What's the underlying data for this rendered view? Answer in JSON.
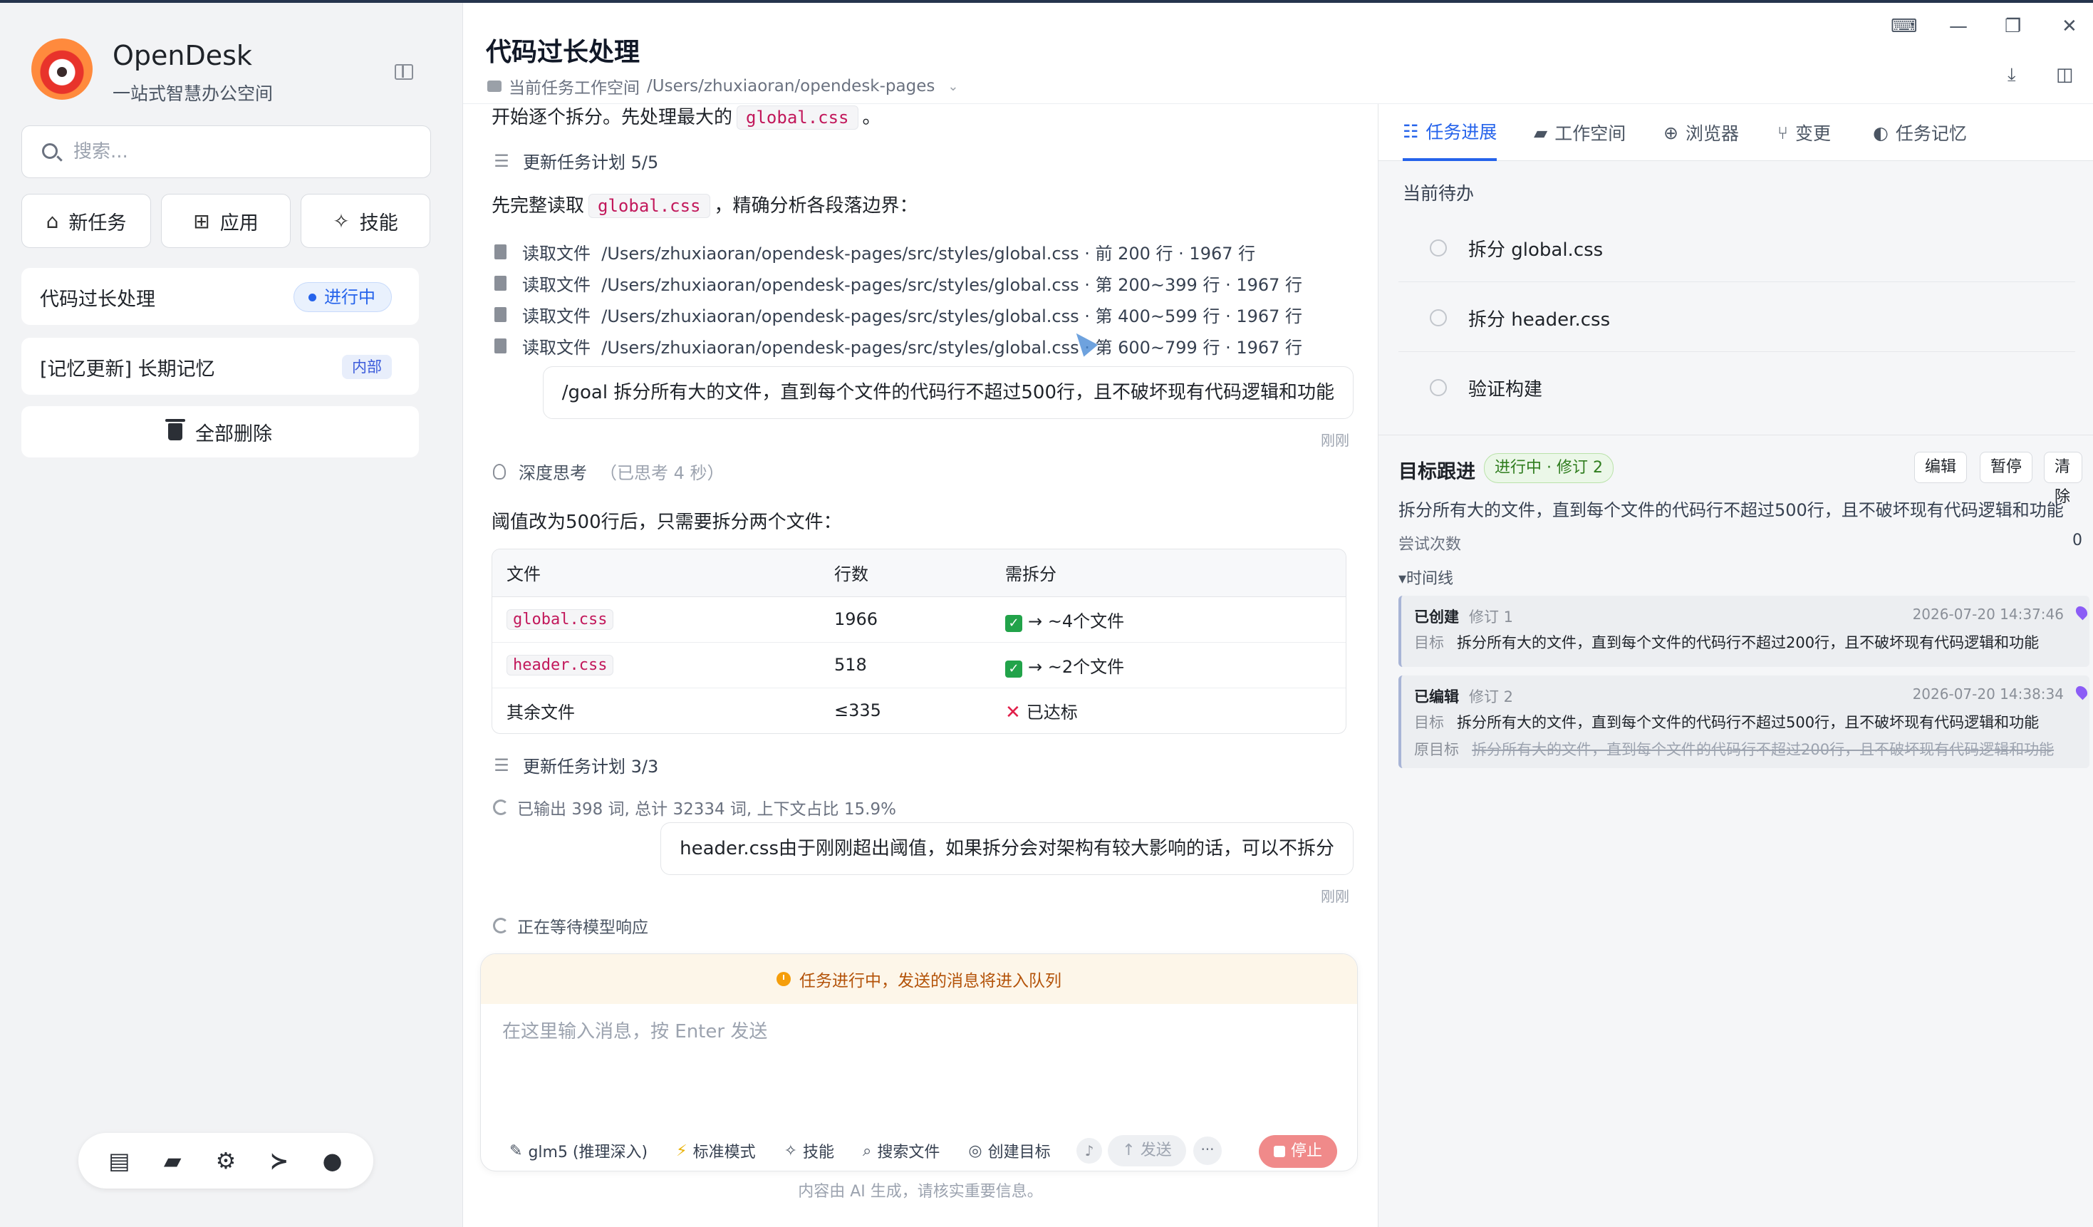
{
  "app": {
    "name": "OpenDesk",
    "tagline": "一站式智慧办公空间"
  },
  "sidebar": {
    "search_placeholder": "搜索...",
    "buttons": [
      {
        "label": "新任务",
        "icon": "home-icon"
      },
      {
        "label": "应用",
        "icon": "grid-icon"
      },
      {
        "label": "技能",
        "icon": "magic-wand-icon"
      }
    ],
    "tasks": [
      {
        "label": "代码过长处理",
        "badge": "进行中"
      },
      {
        "label": "[记忆更新] 长期记忆",
        "badge": "内部"
      }
    ],
    "delete_all": "全部删除",
    "bottom_icons": [
      "dashboard-icon",
      "folder-icon",
      "gear-icon",
      "terminal-icon",
      "account-icon"
    ]
  },
  "header": {
    "title": "代码过长处理",
    "workspace_label": "当前任务工作空间",
    "workspace_path": "/Users/zhuxiaoran/opendesk-pages"
  },
  "chat": {
    "intro_prefix": "开始逐个拆分。先处理最大的",
    "intro_code": "global.css",
    "intro_suffix": "。",
    "plan_update_1": "更新任务计划  5/5",
    "read_prefix": "先完整读取",
    "read_code": "global.css",
    "read_suffix": "，精确分析各段落边界：",
    "file_reads": [
      {
        "label": "读取文件",
        "path": "/Users/zhuxiaoran/opendesk-pages/src/styles/global.css",
        "range": "· 前 200 行 · 1967 行"
      },
      {
        "label": "读取文件",
        "path": "/Users/zhuxiaoran/opendesk-pages/src/styles/global.css",
        "range": "· 第 200~399 行 · 1967 行"
      },
      {
        "label": "读取文件",
        "path": "/Users/zhuxiaoran/opendesk-pages/src/styles/global.css",
        "range": "· 第 400~599 行 · 1967 行"
      },
      {
        "label": "读取文件",
        "path": "/Users/zhuxiaoran/opendesk-pages/src/styles/global.css",
        "range": "· 第 600~799 行 · 1967 行"
      }
    ],
    "user_msg_1": "/goal 拆分所有大的文件，直到每个文件的代码行不超过500行，且不破坏现有代码逻辑和功能",
    "ts_1": "刚刚",
    "thinking_label": "深度思考",
    "thinking_duration": "（已思考 4 秒）",
    "threshold_text": "阈值改为500行后，只需要拆分两个文件：",
    "table": {
      "headers": [
        "文件",
        "行数",
        "需拆分"
      ],
      "rows": [
        {
          "file": "global.css",
          "code": true,
          "lines": "1966",
          "ok": true,
          "split": "→ ~4个文件"
        },
        {
          "file": "header.css",
          "code": true,
          "lines": "518",
          "ok": true,
          "split": "→ ~2个文件"
        },
        {
          "file": "其余文件",
          "code": false,
          "lines": "≤335",
          "ok": false,
          "split": "已达标"
        }
      ]
    },
    "plan_update_2": "更新任务计划  3/3",
    "stats": "已输出 398 词, 总计 32334 词, 上下文占比 15.9%",
    "user_msg_2": "header.css由于刚刚超出阈值，如果拆分会对架构有较大影响的话，可以不拆分",
    "ts_2": "刚刚",
    "waiting": "正在等待模型响应"
  },
  "composer": {
    "banner": "任务进行中，发送的消息将进入队列",
    "placeholder": "在这里输入消息，按 Enter 发送",
    "tools": [
      {
        "label": "glm5 (推理深入)",
        "icon": "model-icon"
      },
      {
        "label": "标准模式",
        "icon": "bolt-icon"
      },
      {
        "label": "技能",
        "icon": "magic-wand-icon"
      },
      {
        "label": "搜索文件",
        "icon": "search-icon"
      },
      {
        "label": "创建目标",
        "icon": "target-icon"
      }
    ],
    "send": "发送",
    "more": "···",
    "stop": "停止",
    "disclaimer": "内容由 AI 生成，请核实重要信息。"
  },
  "right_panel": {
    "tabs": [
      {
        "label": "任务进展",
        "icon": "list-icon",
        "active": true
      },
      {
        "label": "工作空间",
        "icon": "folder-icon",
        "active": false
      },
      {
        "label": "浏览器",
        "icon": "globe-icon",
        "active": false
      },
      {
        "label": "变更",
        "icon": "branch-icon",
        "active": false
      },
      {
        "label": "任务记忆",
        "icon": "brain-icon",
        "active": false
      }
    ],
    "todo_title": "当前待办",
    "todos": [
      "拆分 global.css",
      "拆分 header.css",
      "验证构建"
    ],
    "goal": {
      "title": "目标跟进",
      "status": "进行中 · 修订 2",
      "actions": [
        "编辑",
        "暂停",
        "清除"
      ],
      "description": "拆分所有大的文件，直到每个文件的代码行不超过500行，且不破坏现有代码逻辑和功能",
      "attempts_label": "尝试次数",
      "attempts_value": "0",
      "timeline_label": "▾时间线",
      "timeline": [
        {
          "action": "已创建",
          "rev": "修订 1",
          "time": "2026-07-20 14:37:46",
          "target_key": "目标",
          "target": "拆分所有大的文件，直到每个文件的代码行不超过200行，且不破坏现有代码逻辑和功能"
        },
        {
          "action": "已编辑",
          "rev": "修订 2",
          "time": "2026-07-20 14:38:34",
          "target_key": "目标",
          "target": "拆分所有大的文件，直到每个文件的代码行不超过500行，且不破坏现有代码逻辑和功能",
          "orig_key": "原目标",
          "orig": "拆分所有大的文件，直到每个文件的代码行不超过200行，且不破坏现有代码逻辑和功能"
        }
      ]
    }
  }
}
